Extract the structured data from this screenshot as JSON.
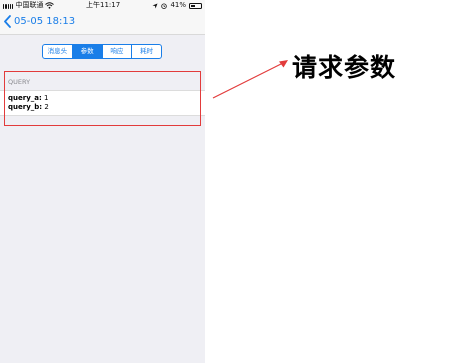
{
  "status_bar": {
    "carrier": "中国联通",
    "time": "上午11:17",
    "battery": "41%",
    "battery_level": 0.41
  },
  "nav": {
    "back_title": "05-05 18:13"
  },
  "tabs": [
    {
      "label": "消息头",
      "active": false
    },
    {
      "label": "参数",
      "active": true
    },
    {
      "label": "响应",
      "active": false
    },
    {
      "label": "耗时",
      "active": false
    }
  ],
  "query_section": {
    "header": "QUERY",
    "params": [
      {
        "key": "query_a:",
        "value": "1"
      },
      {
        "key": "query_b:",
        "value": "2"
      }
    ]
  },
  "annotation": {
    "text": "请求参数",
    "color": "#e23b3b"
  },
  "colors": {
    "accent": "#1a7ee8",
    "highlight": "#e23b3b"
  },
  "icons": [
    "signal-icon",
    "wifi-icon",
    "location-icon",
    "alarm-icon",
    "battery-icon",
    "back-chevron-icon",
    "arrow-icon"
  ]
}
